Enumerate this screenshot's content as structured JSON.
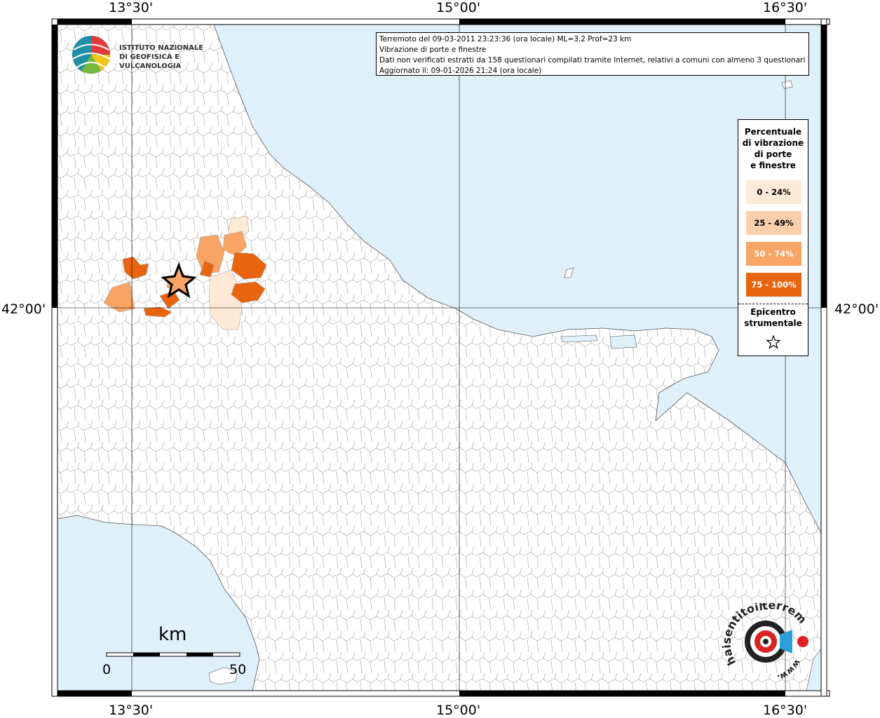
{
  "map": {
    "lon_labels": [
      "13°30'",
      "15°00'",
      "16°30'"
    ],
    "lat_label": "42°00'"
  },
  "infobox": {
    "line1": "Terremoto del 09-03-2011 23:23:36 (ora locale) ML=3.2 Prof=23 km",
    "line2": "Vibrazione di porte e finestre",
    "line3": "Dati non verificati estratti da 158 questionari compilati tramite Internet, relativi a comuni con almeno 3 questionari.",
    "line4": "Aggiornato il: 09-01-2026 21:24 (ora locale)"
  },
  "logo": {
    "line1": "ISTITUTO NAZIONALE",
    "line2": "DI GEOFISICA E VULCANOLOGIA"
  },
  "legend": {
    "title": [
      "Percentuale",
      "di vibrazione",
      "di porte",
      "e finestre"
    ],
    "classes": [
      {
        "label": "0 - 24%",
        "color": "#fde9d6"
      },
      {
        "label": "25 - 49%",
        "color": "#fbcfab"
      },
      {
        "label": "50 - 74%",
        "color": "#f7a464"
      },
      {
        "label": "75 - 100%",
        "color": "#e8640f"
      }
    ],
    "epicentre": [
      "Epicentro",
      "strumentale"
    ]
  },
  "scalebar": {
    "unit": "km",
    "start": "0",
    "end": "50"
  },
  "hsit_logo": {
    "text": "haisentitoilterremoto.it",
    "prefix": "www."
  },
  "colors": {
    "sea": "#dff0fb",
    "land": "#ffffff",
    "border": "#9a9a9a"
  }
}
